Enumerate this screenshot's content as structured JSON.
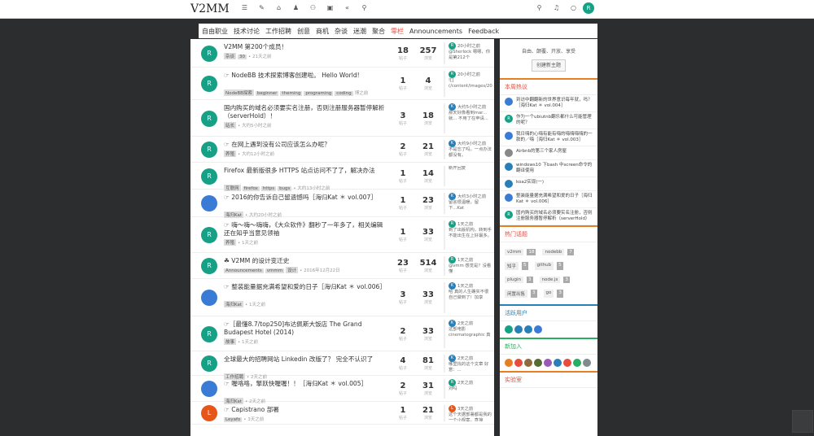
{
  "brand": {
    "logo": "V2MM"
  },
  "nav": {
    "icons": [
      "bars-icon",
      "pencil-icon",
      "tags-icon",
      "user-icon",
      "groups-icon",
      "inbox-icon",
      "backward-icon",
      "search-icon"
    ]
  },
  "right_icons": [
    "search-icon",
    "bell-icon",
    "chat-icon"
  ],
  "user": {
    "initial": "R"
  },
  "categories": [
    "自由职业",
    "技术讨论",
    "工作招聘",
    "创意",
    "商机",
    "杂谈",
    "迷潮",
    "聚合",
    "零栏",
    "Announcements",
    "Feedback"
  ],
  "topics": [
    {
      "initial": "R",
      "color": "#16a085",
      "title": "V2MM 第200个成员！",
      "tags": [
        "杂谈",
        "30"
      ],
      "time": "• 21天之前",
      "posts": "18",
      "views": "257",
      "last_user": "R",
      "last_color": "#16a085",
      "last_time": "20小时之前",
      "last_text": "@Sherlock 嗯嗯，你是第212个"
    },
    {
      "initial": "R",
      "color": "#16a085",
      "title": "☞ NodeBB 技术探索博客创建啦。 Hello World!",
      "tags": [
        "NodeBB探索",
        "beginner",
        "theming",
        "programing",
        "coding"
      ],
      "time": "博之前",
      "posts": "1",
      "views": "4",
      "last_user": "R",
      "last_color": "#16a085",
      "last_time": "20小时之前",
      "last_text": "![](/content/images/20..."
    },
    {
      "initial": "R",
      "color": "#16a085",
      "title": "国内购买的域名必须要实名注册，否则注册服务器暂停解析（serverHold）！",
      "tags": [
        "站长"
      ],
      "time": "• 大约5小时之前",
      "posts": "3",
      "views": "18",
      "last_user": "K",
      "last_color": "#2980b9",
      "last_time": "大约5小时之前",
      "last_text": "那天好像看到mar...就... 不用了在申请..."
    },
    {
      "initial": "R",
      "color": "#16a085",
      "title": "☞ 在网上遇到没有公司应该怎么办呢？",
      "tags": [
        "养殖"
      ],
      "time": "• 大约12小时之前",
      "posts": "2",
      "views": "21",
      "last_user": "K",
      "last_color": "#2980b9",
      "last_time": "大约9小时之前",
      "last_text": "不是忘了吗，一点办法都没有。"
    },
    {
      "initial": "R",
      "color": "#16a085",
      "title": "Firefox 最新版很多 HTTPS 站点访问不了了，解决办法",
      "tags": [
        "互联网",
        "firefox",
        "https",
        "bugs"
      ],
      "time": "• 大约13小时之前",
      "posts": "1",
      "views": "14",
      "last_user": "",
      "last_color": "",
      "last_time": "",
      "last_text": "新开回复"
    },
    {
      "initial": "",
      "color": "#3a7bd5",
      "title": "☞ 2016的你告诉自己留遗憾吗［海归Kat ＊ vol.007］",
      "tags": [
        "海归Kat"
      ],
      "time": "• 大约20小时之前",
      "posts": "1",
      "views": "23",
      "last_user": "K",
      "last_color": "#2980b9",
      "last_time": "大约3小时之前",
      "last_text": "留言很温暖，留下...Kat"
    },
    {
      "initial": "R",
      "color": "#16a085",
      "title": "☞ 嗨～嗨～嗨嗨，《大众软件》翻秒了一年多了，相关编辑还在知乎当意见领袖",
      "tags": [
        "养殖"
      ],
      "time": "• 1天之前",
      "posts": "1",
      "views": "33",
      "last_user": "R",
      "last_color": "#16a085",
      "last_time": "1天之前",
      "last_text": "到了出版机构，转到手不能出生在上好最多。"
    },
    {
      "initial": "R",
      "color": "#16a085",
      "title": "☘ V2MM 的设计变迁史",
      "tags": [
        "Announcements",
        "vmmm",
        "设计"
      ],
      "time": "• 2016年12月22日",
      "posts": "23",
      "views": "514",
      "last_user": "R",
      "last_color": "#16a085",
      "last_time": "1天之前",
      "last_text": "@vmm 感觉是？没看懂"
    },
    {
      "initial": "",
      "color": "#3a7bd5",
      "title": "☞ 整装能量据充满希望和爱的日子［海归Kat ＊ vol.006］",
      "tags": [
        "海归Kat"
      ],
      "time": "• 1天之前",
      "posts": "3",
      "views": "33",
      "last_user": "K",
      "last_color": "#2980b9",
      "last_time": "1天之前",
      "last_text": "哈 真的人生确实不很自己做到了！加享"
    },
    {
      "initial": "R",
      "color": "#16a085",
      "title": "☞［最懂8.7/top250]布达佩斯大饭店 The Grand Budapest Hotel (2014)",
      "tags": [
        "故事"
      ],
      "time": "• 1天之前",
      "posts": "2",
      "views": "33",
      "last_user": "K",
      "last_color": "#2980b9",
      "last_time": "2天之前",
      "last_text": "这部电影 cinematographic 真"
    },
    {
      "initial": "R",
      "color": "#16a085",
      "title": "全球最大的招聘网站 Linkedin 改版了？ 完全不认识了",
      "tags": [
        "工作招聘"
      ],
      "time": "• 2天之前",
      "posts": "4",
      "views": "81",
      "last_user": "K",
      "last_color": "#2980b9",
      "last_time": "2天之前",
      "last_text": "哪里找的这个文章 好意：..."
    },
    {
      "initial": "",
      "color": "#3a7bd5",
      "title": "☞ 喔咯咯，擎跃快喔喔！！［海归Kat ＊ vol.005］",
      "tags": [
        "海归Kat"
      ],
      "time": "• 2天之前",
      "posts": "2",
      "views": "31",
      "last_user": "R",
      "last_color": "#16a085",
      "last_time": "2天之前",
      "last_text": "对吗"
    },
    {
      "initial": "L",
      "color": "#e6561a",
      "title": "☞ Capistrano 部署",
      "tags": [
        "Leyafo"
      ],
      "time": "• 3天之前",
      "posts": "1",
      "views": "21",
      "last_user": "L",
      "last_color": "#e6561a",
      "last_time": "3天之前",
      "last_text": "这个天据部署都是我的一个小规案，直接"
    }
  ],
  "sidebar": {
    "slogan": "自由、颠覆、开放、享受",
    "new_topic": "创建新主题",
    "hot_title": "本周热议",
    "hot": [
      {
        "initial": "",
        "color": "#3a7bd5",
        "text": "到访中翻翻新的世界意识每年就，吗？［海归Kat ＊ vol.004］"
      },
      {
        "initial": "R",
        "color": "#16a085",
        "text": "作为一个ubiutnb翻乐都什么可能管理的呢？"
      },
      {
        "initial": "",
        "color": "#3a7bd5",
        "text": "我日嗨的心嗨有能有嗨的嗨嗨嗨嗨的一款的／嗨［海归Kat ＊ vol.003］"
      },
      {
        "initial": "",
        "color": "#888",
        "text": "Airbnb的第三个家人房屋"
      },
      {
        "initial": "",
        "color": "#2980b9",
        "text": "windows10 下bash 中screen命令的翻译使用"
      },
      {
        "initial": "",
        "color": "#2980b9",
        "text": "koa2实现(一)"
      },
      {
        "initial": "",
        "color": "#3a7bd5",
        "text": "整装能量据充满希望和爱的日子［海归Kat ＊ vol.006］"
      },
      {
        "initial": "R",
        "color": "#16a085",
        "text": "国内购买的域名必须要实名注册，否则注册服务器暂停解析（serverHold）"
      }
    ],
    "tags_title": "热门话题",
    "tags": [
      [
        "v2mm",
        "18"
      ],
      [
        "nodebb",
        "7"
      ],
      [
        "知乎",
        "5"
      ],
      [
        "github",
        "5"
      ],
      [
        "plugin",
        "3"
      ],
      [
        "node.js",
        "3"
      ],
      [
        "闲置出售",
        "3"
      ],
      [
        "go",
        "3"
      ]
    ],
    "active_title": "活跃用户",
    "active_colors": [
      "#16a085",
      "#2980b9",
      "#2980b9",
      "#3a7bd5"
    ],
    "new_title": "新加入",
    "new_colors": [
      "#e67e22",
      "#e74c3c",
      "#8e6b3d",
      "#556b2f",
      "#9b59b6",
      "#2980b9",
      "#e74c3c",
      "#27ae60",
      "#7f8c8d"
    ],
    "lab_title": "实验室"
  }
}
